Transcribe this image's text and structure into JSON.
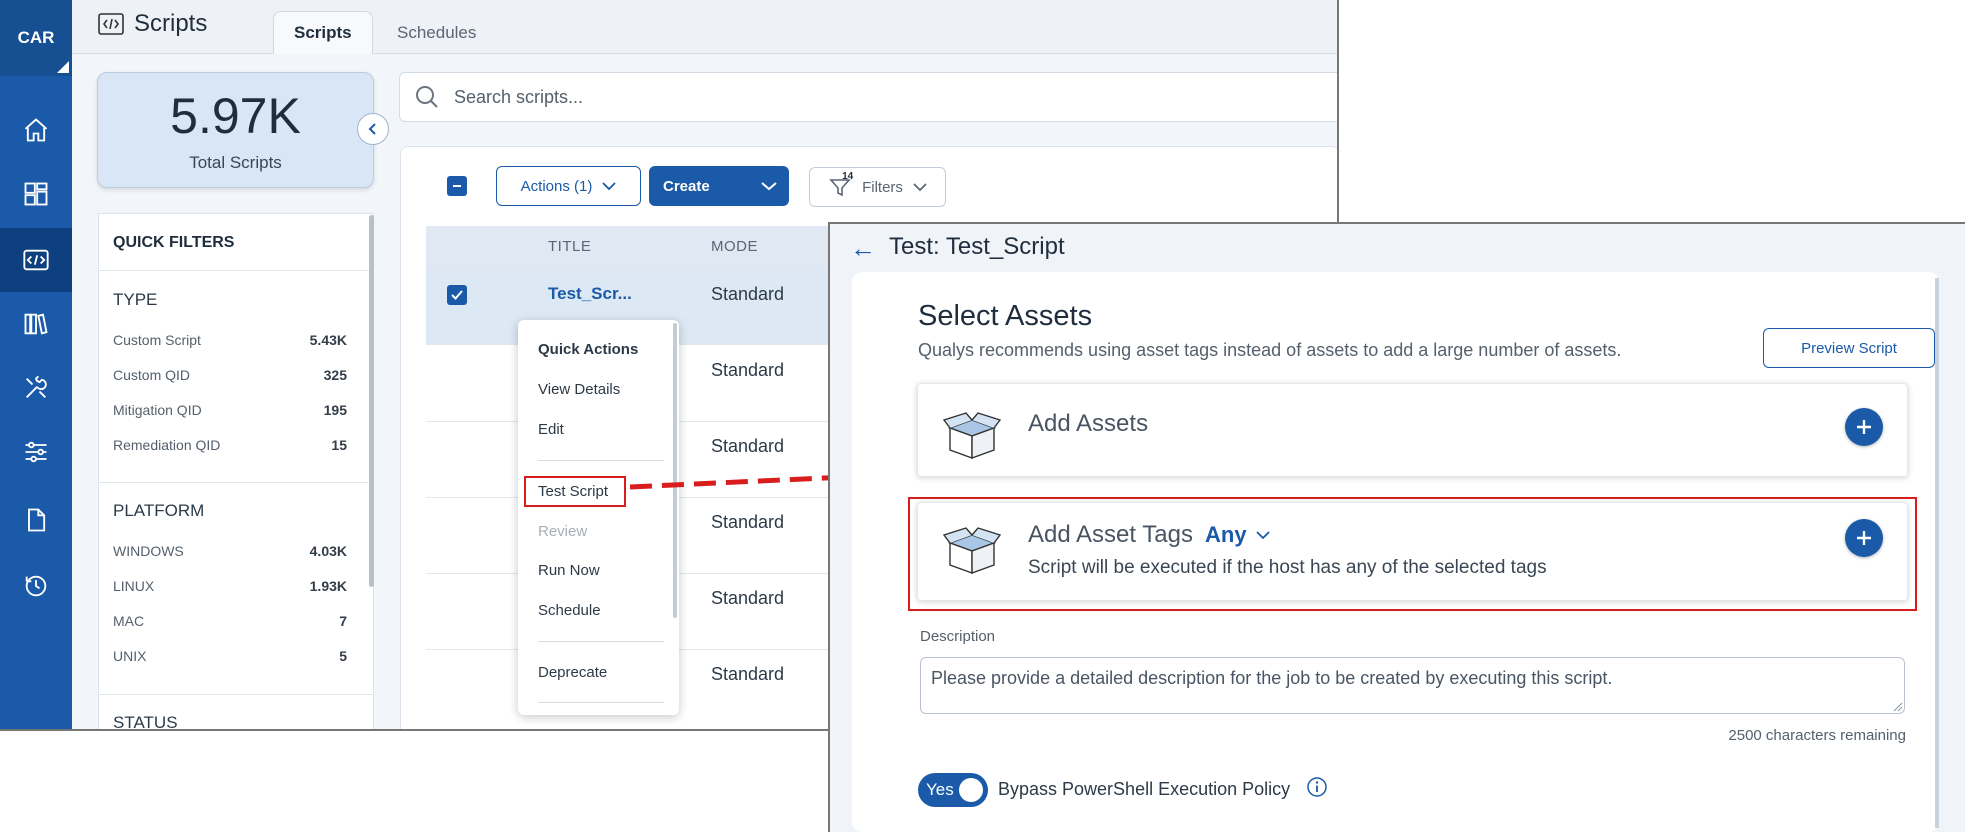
{
  "app": {
    "logo": "CAR",
    "page_title": "Scripts",
    "tabs": [
      {
        "label": "Scripts",
        "active": true
      },
      {
        "label": "Schedules",
        "active": false
      }
    ]
  },
  "rail": {
    "icons": [
      "home-icon",
      "dashboard-icon",
      "scripts-icon",
      "library-icon",
      "tools-icon",
      "settings-sliders-icon",
      "document-icon",
      "history-icon"
    ],
    "active": "scripts-icon"
  },
  "stats": {
    "value": "5.97K",
    "label": "Total Scripts"
  },
  "search": {
    "placeholder": "Search scripts..."
  },
  "quick_filters": {
    "title": "QUICK FILTERS",
    "type": {
      "title": "TYPE",
      "items": [
        {
          "label": "Custom Script",
          "count": "5.43K"
        },
        {
          "label": "Custom QID",
          "count": "325"
        },
        {
          "label": "Mitigation QID",
          "count": "195"
        },
        {
          "label": "Remediation QID",
          "count": "15"
        }
      ]
    },
    "platform": {
      "title": "PLATFORM",
      "items": [
        {
          "label": "WINDOWS",
          "count": "4.03K"
        },
        {
          "label": "LINUX",
          "count": "1.93K"
        },
        {
          "label": "MAC",
          "count": "7"
        },
        {
          "label": "UNIX",
          "count": "5"
        }
      ]
    },
    "status": {
      "title": "STATUS"
    }
  },
  "toolbar": {
    "actions_label": "Actions (1)",
    "create_label": "Create",
    "filters_label": "Filters",
    "filters_badge": "14"
  },
  "table": {
    "columns": [
      "TITLE",
      "MODE"
    ],
    "rows": [
      {
        "title": "Test_Scr...",
        "mode": "Standard",
        "selected": true
      },
      {
        "title": "",
        "mode": "Standard",
        "selected": false
      },
      {
        "title": "",
        "mode": "Standard",
        "selected": false
      },
      {
        "title": "",
        "mode": "Standard",
        "selected": false
      },
      {
        "title": "",
        "mode": "Standard",
        "selected": false
      },
      {
        "title": "",
        "mode": "Standard",
        "selected": false
      }
    ]
  },
  "context_menu": {
    "header": "Quick Actions",
    "items": [
      "View Details",
      "Edit",
      "Test Script",
      "Review",
      "Run Now",
      "Schedule",
      "Deprecate"
    ],
    "highlighted": "Test Script",
    "disabled": [
      "Review"
    ]
  },
  "panel": {
    "back_arrow": "←",
    "title": "Test: Test_Script",
    "section_title": "Select Assets",
    "section_subtitle": "Qualys recommends using asset tags instead of assets to add a large number of assets.",
    "preview_button": "Preview Script",
    "add_assets": {
      "title": "Add Assets"
    },
    "add_asset_tags": {
      "title": "Add Asset Tags",
      "match_mode": "Any",
      "subtitle": "Script will be executed if the host has any of the selected tags"
    },
    "description": {
      "label": "Description",
      "placeholder": "Please provide a detailed description for the job to be created by executing this script.",
      "chars_remaining": "2500 characters remaining"
    },
    "bypass": {
      "toggle_label": "Yes",
      "enabled": true,
      "label": "Bypass PowerShell Execution Policy"
    }
  },
  "colors": {
    "primary": "#1a5aa8",
    "rail": "#1a5aa8",
    "highlight": "#d91d1d"
  }
}
